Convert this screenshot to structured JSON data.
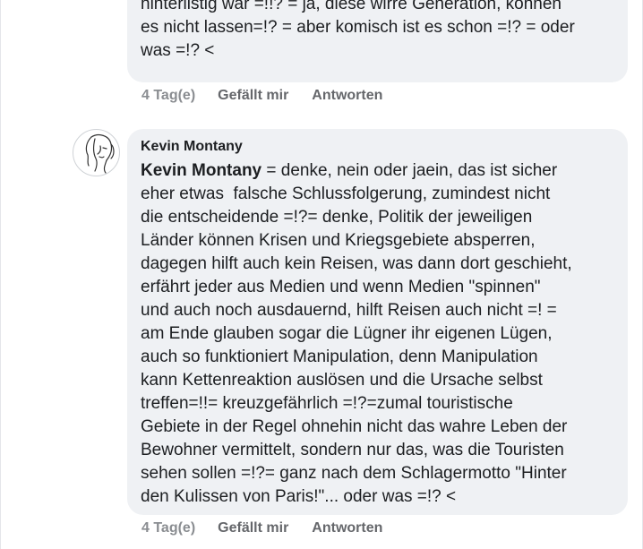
{
  "comments": [
    {
      "lines": [
        "hinterlistig war =!!? = ja, diese wirre Generation, können",
        "es nicht lassen=!? = aber komisch ist es schon =!? = oder",
        "was =!? <"
      ],
      "time": "4 Tag(e)",
      "like_label": "Gefällt mir",
      "reply_label": "Antworten"
    },
    {
      "author": "Kevin Montany",
      "mention": "Kevin Montany",
      "first_line_rest": " = denke, nein oder jaein, das ist sicher",
      "lines": [
        "eher etwas  falsche Schlussfolgerung, zumindest nicht",
        "die entscheidende =!?= denke, Politik der jeweiligen",
        "Länder können Krisen und Kriegsgebiete absperren,",
        "dagegen hilft auch kein Reisen, was dann dort geschieht,",
        "erfährt jeder aus Medien und wenn Medien \"spinnen\"",
        "und auch noch ausdauernd, hilft Reisen auch nicht =! =",
        "am Ende glauben sogar die Lügner ihr eigenen Lügen,",
        "auch so funktioniert Manipulation, denn Manipulation",
        "kann Kettenreaktion auslösen und die Ursache selbst",
        "treffen=!!= kreuzgefährlich =!?=zumal touristische",
        "Gebiete in der Regel ohnehin nicht das wahre Leben der",
        "Bewohner vermittelt, sondern nur das, was die Touristen",
        "sehen sollen =!?= ganz nach dem Schlagermotto \"Hinter",
        "den Kulissen von Paris!\"... oder was =!? <"
      ],
      "time": "4 Tag(e)",
      "like_label": "Gefällt mir",
      "reply_label": "Antworten",
      "avatar_icon": "sketch-face-avatar-icon"
    }
  ],
  "colors": {
    "bubble": "#eff1f4",
    "text": "#1c1e21",
    "meta": "#65676b",
    "time": "#8a8d91"
  }
}
